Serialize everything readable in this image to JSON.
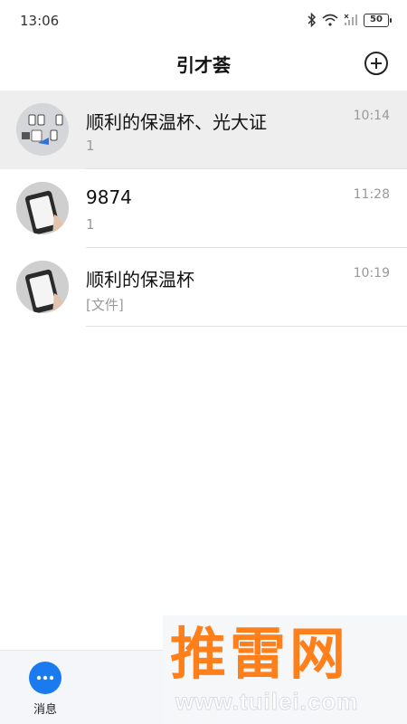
{
  "status_bar": {
    "time": "13:06",
    "battery": "50"
  },
  "header": {
    "title": "引才荟",
    "add_icon": "plus-circle-icon"
  },
  "chats": [
    {
      "name": "顺利的保温杯、光大证",
      "time": "10:14",
      "preview": "1",
      "avatar": "group-avatar",
      "selected": true
    },
    {
      "name": "9874",
      "time": "11:28",
      "preview": "1",
      "avatar": "phone-photo-avatar",
      "selected": false
    },
    {
      "name": "顺利的保温杯",
      "time": "10:19",
      "preview": "[文件]",
      "avatar": "phone-photo-avatar",
      "selected": false
    }
  ],
  "bottom_nav": {
    "items": [
      {
        "label": "消息",
        "icon": "chat-dots-icon",
        "active": true
      }
    ]
  },
  "watermark": {
    "logo": "推雷网",
    "url": "www.tuilei.com"
  },
  "colors": {
    "accent": "#1a7bf0",
    "selected_row": "#eeeeee",
    "watermark_orange": "#ff7f1a"
  }
}
